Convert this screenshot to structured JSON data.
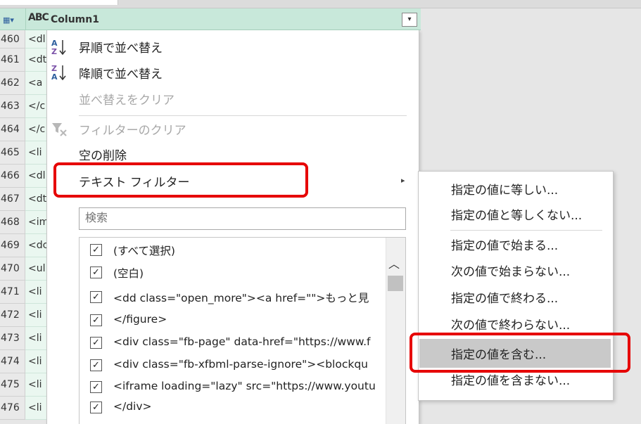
{
  "column": {
    "title": "Column1",
    "type_icon": "ABC",
    "table_icon": "▦▾",
    "dropdown_glyph": "▾"
  },
  "rows": [
    {
      "num": "460",
      "cell": "<dl"
    },
    {
      "num": "461",
      "cell": "<dt"
    },
    {
      "num": "462",
      "cell": "<a"
    },
    {
      "num": "463",
      "cell": "</c"
    },
    {
      "num": "464",
      "cell": "</c"
    },
    {
      "num": "465",
      "cell": "<li"
    },
    {
      "num": "466",
      "cell": "<dl"
    },
    {
      "num": "467",
      "cell": "<dt"
    },
    {
      "num": "468",
      "cell": "<im"
    },
    {
      "num": "469",
      "cell": "<dc"
    },
    {
      "num": "470",
      "cell": "<ul"
    },
    {
      "num": "471",
      "cell": "<li"
    },
    {
      "num": "472",
      "cell": "<li"
    },
    {
      "num": "473",
      "cell": "<li"
    },
    {
      "num": "474",
      "cell": "<li"
    },
    {
      "num": "475",
      "cell": "<li"
    },
    {
      "num": "476",
      "cell": "<li"
    }
  ],
  "menu": {
    "sort_asc": "昇順で並べ替え",
    "sort_desc": "降順で並べ替え",
    "clear_sort": "並べ替えをクリア",
    "clear_filter": "フィルターのクリア",
    "remove_empty": "空の削除",
    "text_filter": "テキスト フィルター",
    "submenu_arrow": "▸",
    "search_placeholder": "検索"
  },
  "filter_items": [
    "(すべて選択)",
    "(空白)",
    "<dd class=\"open_more\"><a href=\"\">もっと見",
    "</figure>",
    "<div class=\"fb-page\" data-href=\"https://www.f",
    "<div class=\"fb-xfbml-parse-ignore\"><blockqu",
    "<iframe loading=\"lazy\" src=\"https://www.youtu",
    "</div>"
  ],
  "checkmark": "✓",
  "scroll_up_glyph": "︿",
  "submenu": {
    "equals": "指定の値に等しい...",
    "not_equals": "指定の値と等しくない...",
    "begins_with": "指定の値で始まる...",
    "not_begins_with": "次の値で始まらない...",
    "ends_with": "指定の値で終わる...",
    "not_ends_with": "次の値で終わらない...",
    "contains": "指定の値を含む...",
    "not_contains": "指定の値を含まない..."
  },
  "colors": {
    "header_bg": "#c8e8da",
    "highlight_border": "#e60000",
    "hover_bg": "#c9c9c9"
  }
}
